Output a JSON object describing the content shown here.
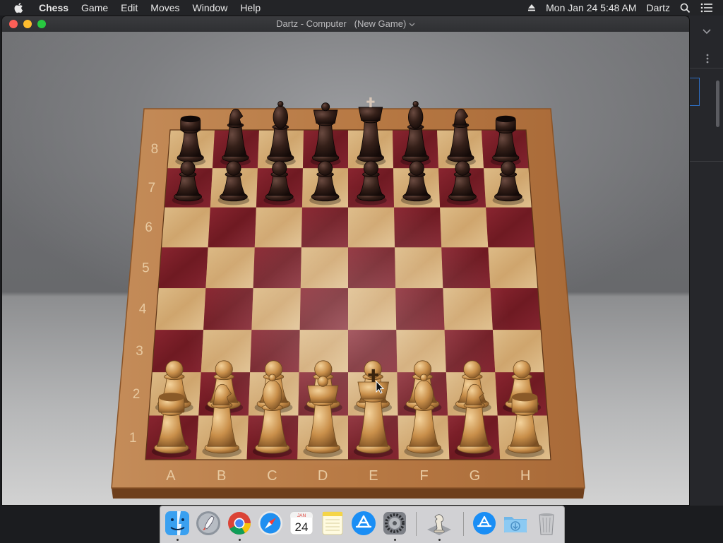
{
  "menubar": {
    "app_name": "Chess",
    "items": [
      "Game",
      "Edit",
      "Moves",
      "Window",
      "Help"
    ],
    "clock": "Mon Jan 24  5:48 AM",
    "user": "Dartz"
  },
  "window": {
    "title": "Dartz - Computer",
    "subtitle": "(New Game)"
  },
  "board": {
    "files": [
      "A",
      "B",
      "C",
      "D",
      "E",
      "F",
      "G",
      "H"
    ],
    "ranks": [
      "8",
      "7",
      "6",
      "5",
      "4",
      "3",
      "2",
      "1"
    ],
    "position": {
      "8": [
        "r",
        "n",
        "b",
        "q",
        "k",
        "b",
        "n",
        "r"
      ],
      "7": [
        "p",
        "p",
        "p",
        "p",
        "p",
        "p",
        "p",
        "p"
      ],
      "2": [
        "P",
        "P",
        "P",
        "P",
        "P",
        "P",
        "P",
        "P"
      ],
      "1": [
        "R",
        "N",
        "B",
        "Q",
        "K",
        "B",
        "N",
        "R"
      ]
    },
    "colors": {
      "light_square": "#d6b17a",
      "dark_square": "#7c1e26",
      "frame": "#b57845",
      "white_piece": "#c7924d",
      "black_piece": "#2e1a16"
    }
  },
  "dock": {
    "calendar_month": "JAN",
    "calendar_day": "24",
    "items": [
      "finder-icon",
      "launchpad-icon",
      "chrome-icon",
      "safari-icon",
      "calendar-icon",
      "notes-icon",
      "app-store-icon",
      "system-preferences-icon",
      "chess-app-icon",
      "app-store-downloads-icon",
      "downloads-folder-icon",
      "trash-icon"
    ]
  }
}
